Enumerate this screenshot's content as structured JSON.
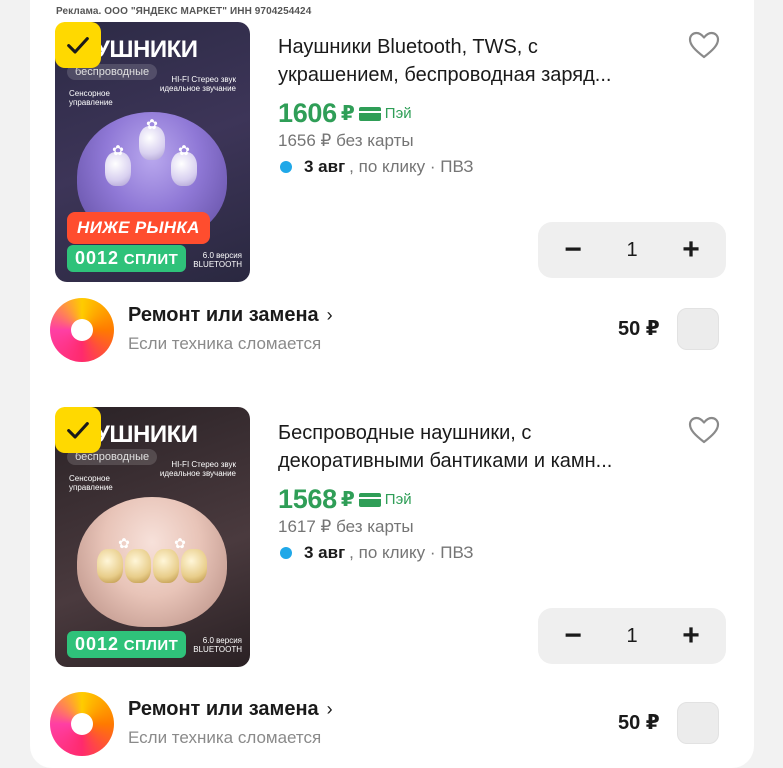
{
  "ad_label": "Реклама. ООО \"ЯНДЕКС МАРКЕТ\" ИНН 9704254424",
  "colors": {
    "price_green": "#2f9e57",
    "check_yellow": "#ffd900",
    "below_market_red": "#ff4d2e",
    "split_green": "#2fc27a",
    "delivery_dot": "#20a8e8"
  },
  "items": [
    {
      "image_title": "УШНИКИ",
      "image_subtitle": "беспроводные",
      "image_feature_left": "Сенсорное\nуправление",
      "image_feature_right": "HI-FI Стерео звук\nидеальное звучание",
      "image_version": "6.0 версия\nBLUETOOTH",
      "badge_below_market": "НИЖЕ РЫНКА",
      "badge_split_digits": "0012",
      "badge_split_label": "СПЛИТ",
      "selected": true,
      "title_line1": "Наушники Bluetooth, TWS, с",
      "title_line2": "украшением, беспроводная заряд...",
      "price": "1606",
      "currency": "₽",
      "pay_label": "Пэй",
      "old_price": "1656 ₽ без карты",
      "delivery_date": "3 авг",
      "delivery_rest": ", по клику · ПВЗ",
      "quantity": "1",
      "favorite_icon": "heart-outline-icon",
      "repair_title": "Ремонт или замена",
      "repair_subtitle": "Если техника сломается",
      "repair_price": "50 ₽"
    },
    {
      "image_title": "УШНИКИ",
      "image_subtitle": "беспроводные",
      "image_feature_left": "Сенсорное\nуправление",
      "image_feature_right": "HI-FI Стерео звук\nидеальное звучание",
      "image_version": "6.0 версия\nBLUETOOTH",
      "badge_split_digits": "0012",
      "badge_split_label": "СПЛИТ",
      "selected": true,
      "title_line1": "Беспроводные наушники, с",
      "title_line2": "декоративными бантиками и камн...",
      "price": "1568",
      "currency": "₽",
      "pay_label": "Пэй",
      "old_price": "1617 ₽ без карты",
      "delivery_date": "3 авг",
      "delivery_rest": ", по клику · ПВЗ",
      "quantity": "1",
      "favorite_icon": "heart-outline-icon",
      "repair_title": "Ремонт или замена",
      "repair_subtitle": "Если техника сломается",
      "repair_price": "50 ₽"
    }
  ],
  "stepper": {
    "minus": "−",
    "plus": "+"
  },
  "repair_chevron": "›"
}
